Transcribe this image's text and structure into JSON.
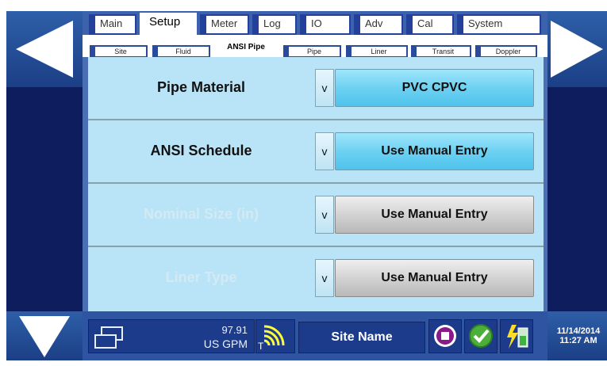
{
  "tabs": [
    {
      "label": "Main"
    },
    {
      "label": "Setup"
    },
    {
      "label": "Meter"
    },
    {
      "label": "Log"
    },
    {
      "label": "IO"
    },
    {
      "label": "Adv"
    },
    {
      "label": "Cal"
    },
    {
      "label": "System"
    }
  ],
  "subtabs": [
    {
      "label": "Site"
    },
    {
      "label": "Fluid"
    },
    {
      "label": "ANSI Pipe"
    },
    {
      "label": "Pipe"
    },
    {
      "label": "Liner"
    },
    {
      "label": "Transit"
    },
    {
      "label": "Doppler"
    }
  ],
  "rows": [
    {
      "label": "Pipe Material",
      "dropdown": "v",
      "value": "PVC CPVC"
    },
    {
      "label": "ANSI Schedule",
      "dropdown": "v",
      "value": "Use Manual Entry"
    },
    {
      "label": "Nominal Size (in)",
      "dropdown": "v",
      "value": "Use Manual Entry"
    },
    {
      "label": "Liner Type",
      "dropdown": "v",
      "value": "Use Manual Entry"
    }
  ],
  "status": {
    "flow_value": "97.91",
    "flow_unit": "US GPM",
    "signal_label": "T",
    "site_name": "Site Name",
    "date": "11/14/2014",
    "time": "11:27 AM"
  },
  "colors": {
    "panel_blue": "#b9e4f7",
    "button_blue": "#6dd1f2",
    "button_gray": "#d3d3d3",
    "frame_navy": "#0d1d5e"
  }
}
